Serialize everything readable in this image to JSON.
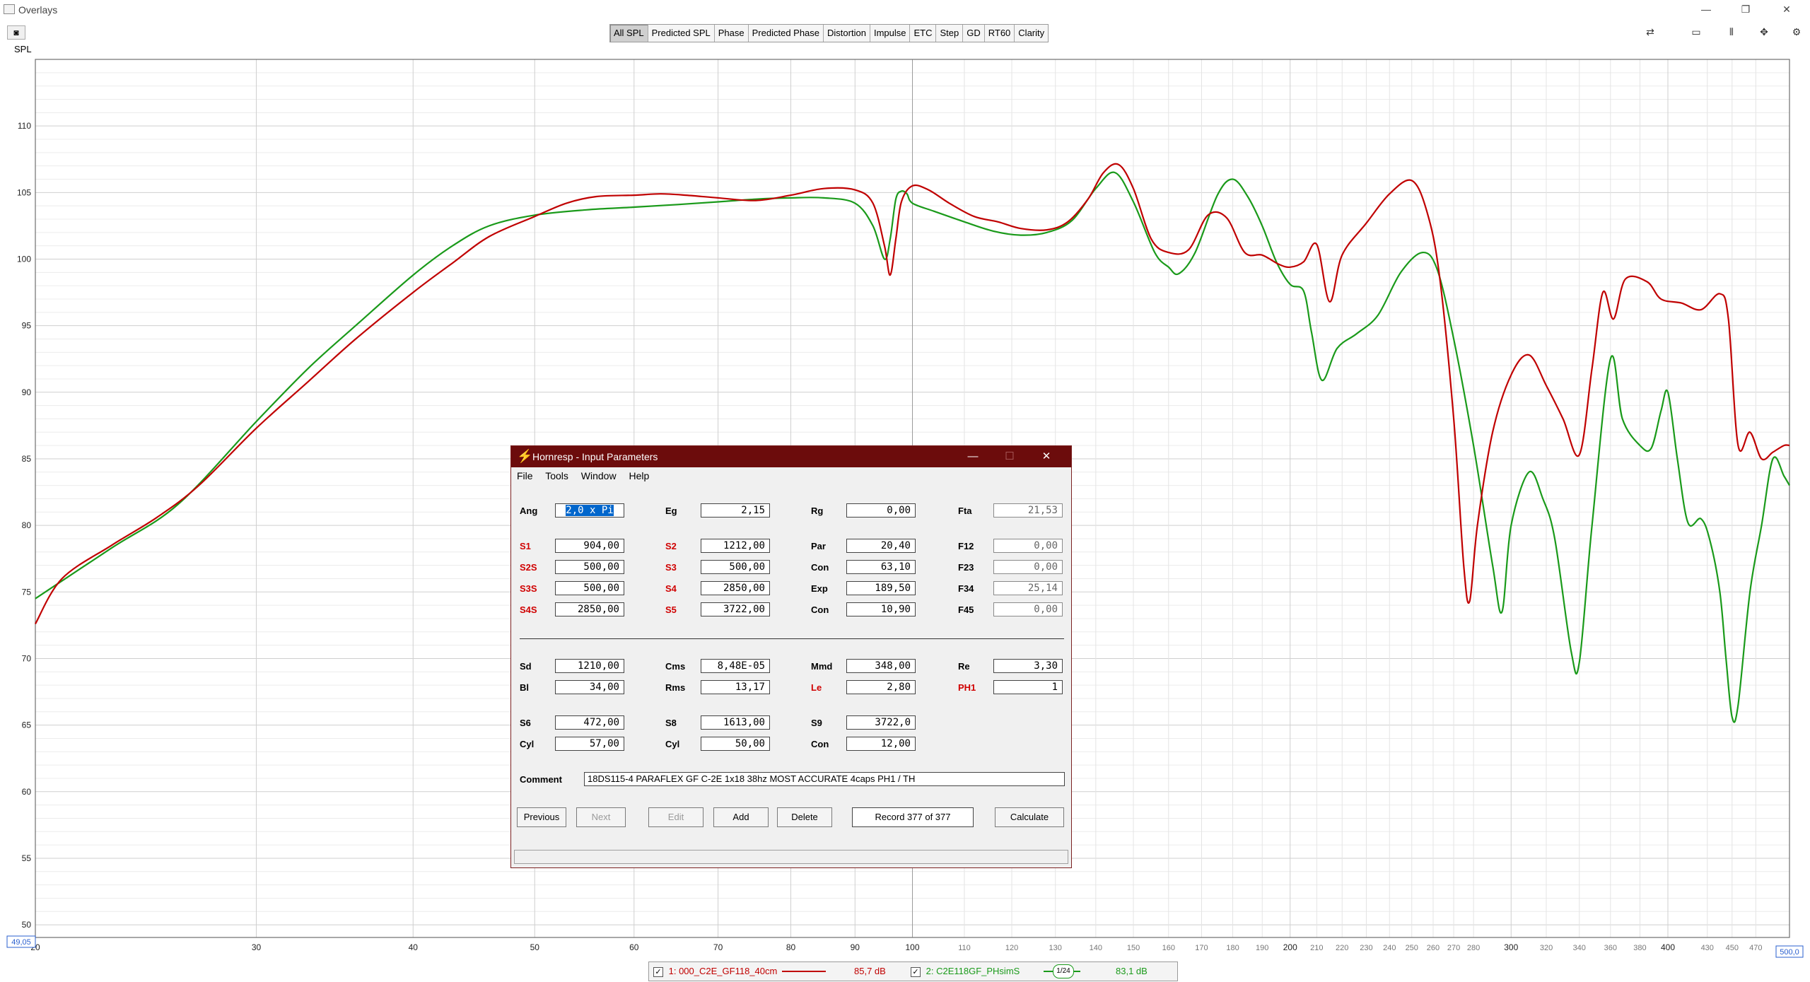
{
  "window": {
    "title": "Overlays",
    "controls": [
      "—",
      "❐",
      "✕"
    ]
  },
  "toolbar": {
    "tabs": [
      "All SPL",
      "Predicted SPL",
      "Phase",
      "Predicted Phase",
      "Distortion",
      "Impulse",
      "ETC",
      "Step",
      "GD",
      "RT60",
      "Clarity"
    ],
    "active": "All SPL"
  },
  "chart_data": {
    "type": "line",
    "ylabel": "SPL",
    "xscale": "log",
    "xlim": [
      20,
      500
    ],
    "ylim": [
      49.05,
      115
    ],
    "x_min_label": "49,05",
    "x_max_label": "500,0",
    "y_ticks": [
      50,
      55,
      60,
      65,
      70,
      75,
      80,
      85,
      90,
      95,
      100,
      105,
      110
    ],
    "x_ticks": [
      20,
      30,
      40,
      50,
      60,
      70,
      80,
      90,
      100,
      110,
      120,
      130,
      140,
      150,
      160,
      170,
      180,
      190,
      200,
      210,
      220,
      230,
      240,
      250,
      260,
      270,
      280,
      300,
      320,
      340,
      360,
      380,
      400,
      430,
      450,
      470
    ],
    "grid": true,
    "series": [
      {
        "name": "1: 000_C2E_GF118_40cm",
        "color": "#c00000",
        "level": "85,7 dB",
        "points": [
          [
            20,
            72.6
          ],
          [
            21,
            76
          ],
          [
            23,
            78.5
          ],
          [
            25,
            80.6
          ],
          [
            27,
            83
          ],
          [
            30,
            87.3
          ],
          [
            33,
            90.8
          ],
          [
            36,
            94
          ],
          [
            40,
            97.5
          ],
          [
            43,
            99.7
          ],
          [
            46,
            101.7
          ],
          [
            50,
            103.2
          ],
          [
            53,
            104.2
          ],
          [
            56,
            104.7
          ],
          [
            60,
            104.8
          ],
          [
            63,
            104.9
          ],
          [
            66,
            104.8
          ],
          [
            70,
            104.6
          ],
          [
            75,
            104.4
          ],
          [
            80,
            104.8
          ],
          [
            85,
            105.3
          ],
          [
            90,
            105.2
          ],
          [
            93,
            104.2
          ],
          [
            95,
            101
          ],
          [
            96,
            98.8
          ],
          [
            97,
            101.5
          ],
          [
            98,
            104.3
          ],
          [
            100,
            105.5
          ],
          [
            103,
            105.2
          ],
          [
            107,
            104.2
          ],
          [
            112,
            103.2
          ],
          [
            117,
            102.8
          ],
          [
            122,
            102.3
          ],
          [
            128,
            102.2
          ],
          [
            133,
            102.8
          ],
          [
            138,
            104.5
          ],
          [
            142,
            106.5
          ],
          [
            146,
            107.1
          ],
          [
            150,
            105.3
          ],
          [
            155,
            101.5
          ],
          [
            160,
            100.5
          ],
          [
            166,
            100.7
          ],
          [
            172,
            103.3
          ],
          [
            178,
            103.1
          ],
          [
            184,
            100.5
          ],
          [
            190,
            100.3
          ],
          [
            196,
            99.6
          ],
          [
            200,
            99.4
          ],
          [
            205,
            99.8
          ],
          [
            210,
            101.1
          ],
          [
            215,
            96.8
          ],
          [
            220,
            100.3
          ],
          [
            230,
            102.7
          ],
          [
            240,
            104.9
          ],
          [
            250,
            105.9
          ],
          [
            257,
            103.6
          ],
          [
            263,
            98.8
          ],
          [
            270,
            88
          ],
          [
            275,
            77
          ],
          [
            278,
            74.3
          ],
          [
            282,
            80
          ],
          [
            290,
            87
          ],
          [
            300,
            91.3
          ],
          [
            310,
            92.8
          ],
          [
            320,
            90.5
          ],
          [
            330,
            88
          ],
          [
            340,
            85.3
          ],
          [
            348,
            91.8
          ],
          [
            355,
            97.5
          ],
          [
            362,
            95.5
          ],
          [
            370,
            98.5
          ],
          [
            385,
            98.3
          ],
          [
            395,
            97
          ],
          [
            410,
            96.7
          ],
          [
            425,
            96.2
          ],
          [
            440,
            97.4
          ],
          [
            447,
            95.5
          ],
          [
            455,
            86
          ],
          [
            465,
            87
          ],
          [
            475,
            85
          ],
          [
            485,
            85.5
          ],
          [
            495,
            86
          ],
          [
            500,
            86
          ]
        ]
      },
      {
        "name": "2: C2E118GF_PHsimS",
        "color": "#1a9a1a",
        "level": "83,1 dB",
        "points": [
          [
            20,
            74.5
          ],
          [
            23,
            78.3
          ],
          [
            26,
            81.6
          ],
          [
            30,
            87.8
          ],
          [
            33,
            91.8
          ],
          [
            36,
            95
          ],
          [
            40,
            98.8
          ],
          [
            43,
            101
          ],
          [
            46,
            102.5
          ],
          [
            50,
            103.3
          ],
          [
            55,
            103.7
          ],
          [
            60,
            103.9
          ],
          [
            65,
            104.1
          ],
          [
            70,
            104.3
          ],
          [
            75,
            104.5
          ],
          [
            80,
            104.6
          ],
          [
            85,
            104.6
          ],
          [
            90,
            104.2
          ],
          [
            93,
            102.5
          ],
          [
            95,
            100
          ],
          [
            96,
            101.5
          ],
          [
            97,
            104.5
          ],
          [
            98,
            105.1
          ],
          [
            99,
            104.9
          ],
          [
            100,
            104.2
          ],
          [
            104,
            103.6
          ],
          [
            110,
            102.8
          ],
          [
            116,
            102.1
          ],
          [
            122,
            101.8
          ],
          [
            128,
            102
          ],
          [
            134,
            102.9
          ],
          [
            140,
            105.3
          ],
          [
            145,
            106.5
          ],
          [
            150,
            104.3
          ],
          [
            156,
            100.5
          ],
          [
            160,
            99.4
          ],
          [
            163,
            98.9
          ],
          [
            168,
            100.5
          ],
          [
            175,
            104.8
          ],
          [
            180,
            106
          ],
          [
            185,
            104.7
          ],
          [
            190,
            102.5
          ],
          [
            195,
            99.8
          ],
          [
            200,
            98.1
          ],
          [
            205,
            97.6
          ],
          [
            208,
            94.5
          ],
          [
            212,
            90.9
          ],
          [
            218,
            93.3
          ],
          [
            226,
            94.4
          ],
          [
            235,
            95.8
          ],
          [
            245,
            99
          ],
          [
            255,
            100.5
          ],
          [
            262,
            99.2
          ],
          [
            270,
            94
          ],
          [
            280,
            86
          ],
          [
            290,
            77
          ],
          [
            295,
            73.5
          ],
          [
            300,
            80
          ],
          [
            310,
            84
          ],
          [
            318,
            82
          ],
          [
            325,
            79
          ],
          [
            335,
            70.5
          ],
          [
            340,
            69.7
          ],
          [
            348,
            80
          ],
          [
            360,
            92.5
          ],
          [
            368,
            88
          ],
          [
            380,
            86
          ],
          [
            388,
            85.8
          ],
          [
            395,
            88.6
          ],
          [
            400,
            90
          ],
          [
            407,
            85
          ],
          [
            415,
            80.2
          ],
          [
            425,
            80.5
          ],
          [
            432,
            78.9
          ],
          [
            440,
            75
          ],
          [
            445,
            70
          ],
          [
            450,
            65.6
          ],
          [
            455,
            66.5
          ],
          [
            465,
            75
          ],
          [
            475,
            80
          ],
          [
            485,
            85
          ],
          [
            495,
            83.7
          ],
          [
            500,
            83
          ]
        ]
      }
    ]
  },
  "dialog": {
    "title": "Hornresp - Input Parameters",
    "menu": [
      "File",
      "Tools",
      "Window",
      "Help"
    ],
    "fields": {
      "Ang": "2,0 x Pi",
      "Eg": "2,15",
      "Rg": "0,00",
      "Fta": "21,53",
      "S1": "904,00",
      "S2": "1212,00",
      "Par": "20,40",
      "F12": "0,00",
      "S2S": "500,00",
      "S3": "500,00",
      "Con1": "63,10",
      "F23": "0,00",
      "S3S": "500,00",
      "S4": "2850,00",
      "Exp": "189,50",
      "F34": "25,14",
      "S4S": "2850,00",
      "S5": "3722,00",
      "Con2": "10,90",
      "F45": "0,00",
      "Sd": "1210,00",
      "Cms": "8,48E-05",
      "Mmd": "348,00",
      "Re": "3,30",
      "Bl": "34,00",
      "Rms": "13,17",
      "Le": "2,80",
      "PH1": "1",
      "S6": "472,00",
      "S8": "1613,00",
      "S9": "3722,0",
      "Cyl1": "57,00",
      "Cyl2": "50,00",
      "Con3": "12,00"
    },
    "labels": {
      "Ang": "Ang",
      "Eg": "Eg",
      "Rg": "Rg",
      "Fta": "Fta",
      "S1": "S1",
      "S2": "S2",
      "Par": "Par",
      "F12": "F12",
      "S2S": "S2S",
      "S3": "S3",
      "Con": "Con",
      "F23": "F23",
      "S3S": "S3S",
      "S4": "S4",
      "Exp": "Exp",
      "F34": "F34",
      "S4S": "S4S",
      "S5": "S5",
      "F45": "F45",
      "Sd": "Sd",
      "Cms": "Cms",
      "Mmd": "Mmd",
      "Re": "Re",
      "Bl": "Bl",
      "Rms": "Rms",
      "Le": "Le",
      "PH1": "PH1",
      "S6": "S6",
      "S8": "S8",
      "S9": "S9",
      "Cyl": "Cyl",
      "Comment": "Comment"
    },
    "comment": "18DS115-4 PARAFLEX GF C-2E 1x18 38hz MOST ACCURATE  4caps PH1 / TH",
    "buttons": {
      "previous": "Previous",
      "next": "Next",
      "edit": "Edit",
      "add": "Add",
      "delete": "Delete",
      "record": "Record 377 of 377",
      "calculate": "Calculate"
    }
  },
  "legend": {
    "smoothing": "1/24"
  }
}
